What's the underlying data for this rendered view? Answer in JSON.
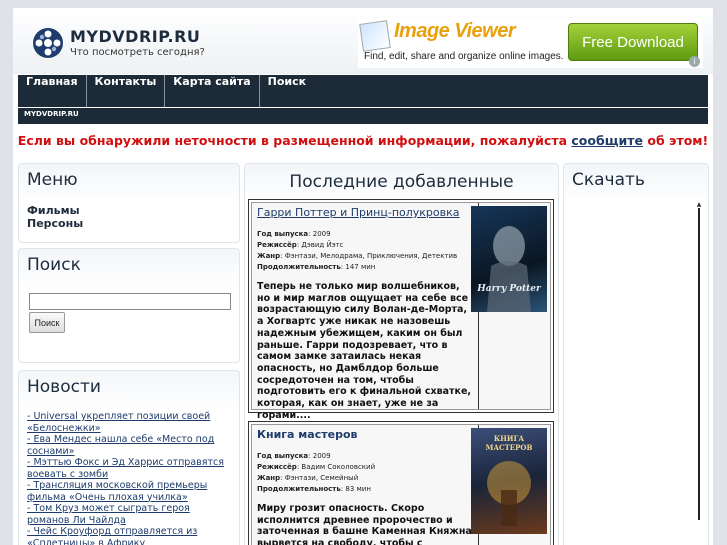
{
  "header": {
    "site_name": "MYDVDRIP.RU",
    "tagline": "Что посмотреть сегодня?"
  },
  "banner": {
    "title": "Image Viewer",
    "tagline": "Find, edit, share and organize online images.",
    "button": "Free Download",
    "info": "i"
  },
  "nav": {
    "items": [
      {
        "label": "Главная"
      },
      {
        "label": "Контакты"
      },
      {
        "label": "Карта сайта"
      },
      {
        "label": "Поиск"
      }
    ]
  },
  "breadcrumb": "MYDVDRIP.RU",
  "notice": {
    "before": "Если вы обнаружили неточности в размещенной информации, пожалуйста ",
    "link": "сообщите",
    "after": " об этом!"
  },
  "menu": {
    "title": "Меню",
    "items": [
      {
        "label": "Фильмы"
      },
      {
        "label": "Персоны"
      }
    ]
  },
  "search": {
    "title": "Поиск",
    "value": "",
    "button": "Поиск"
  },
  "news": {
    "title": "Новости",
    "items": [
      "- Universal укрепляет позиции своей «Белоснежки»",
      "- Ева Мендес нашла себе «Место под соснами»",
      "- Мэттью Фокс и Эд Харрис отправятся воевать с зомби",
      "- Трансляция московской премьеры фильма «Очень плохая училка»",
      "- Том Круз может сыграть героя романов Ли Чайлда",
      "- Чейс Кроуфорд отправляется из «Сплетницы» в Африку"
    ]
  },
  "latest": {
    "title": "Последние добавленные",
    "films": [
      {
        "title": "Гарри Поттер и Принц-полукровка",
        "year_label": "Год выпуска",
        "year": "2009",
        "director_label": "Режиссёр",
        "director": "Дэвид Йэтс",
        "genre_label": "Жанр",
        "genre": "Фэнтази, Мелодрама, Приключения, Детектив",
        "duration_label": "Продолжительность",
        "duration": "147 мин",
        "description": "Теперь не только мир волшебников, но и мир маглов ощущает на себе все возрастающую силу Волан-де-Морта, а Хогвартс уже никак не назовешь надежным убежищем, каким он был раньше. Гарри подозревает, что в самом замке затаилась некая опасность, но Дамблдор больше сосредоточен на том, чтобы подготовить его к финальной схватке, которая, как он знает, уже не за горами....",
        "poster_text": "Harry Potter"
      },
      {
        "title": "Книга мастеров",
        "year_label": "Год выпуска",
        "year": "2009",
        "director_label": "Режиссёр",
        "director": "Вадим Соколовский",
        "genre_label": "Жанр",
        "genre": "Фэнтази, Семейный",
        "duration_label": "Продолжительность",
        "duration": "83 мин",
        "description": "Миру грозит опасность. Скоро исполнится древнее пророчество и заточенная в башне Каменная Княжна вырвется на свободу, чтобы с помощью своих злых",
        "poster_text": "КНИГА МАСТЕРОВ"
      }
    ]
  },
  "download": {
    "title": "Скачать"
  },
  "colors": {
    "nav_bg": "#1d2a38",
    "notice": "#d01010",
    "link": "#1d3c6b",
    "banner_button": "#7bb325"
  }
}
